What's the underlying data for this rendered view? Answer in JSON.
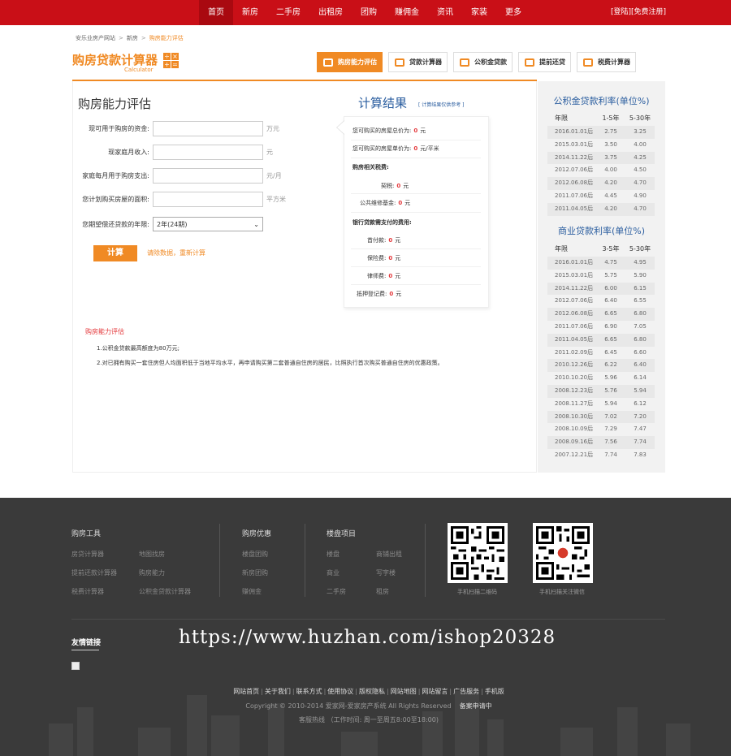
{
  "nav": {
    "items": [
      "首页",
      "新房",
      "二手房",
      "出租房",
      "团购",
      "赚佣金",
      "资讯",
      "家装",
      "更多"
    ],
    "auth": {
      "login": "[登陆]",
      "register": "[免费注册]"
    }
  },
  "breadcrumb": {
    "home": "安乐业房产网站",
    "sep1": ">",
    "mid": "新房",
    "sep2": ">",
    "current": "购房能力评估"
  },
  "logo": {
    "title": "购房贷款计算器",
    "subtitle": "Calculator"
  },
  "tools": [
    {
      "label": "购房能力评估",
      "icon": "house-icon"
    },
    {
      "label": "贷款计算器",
      "icon": "calculator-icon"
    },
    {
      "label": "公积金贷款",
      "icon": "money-icon"
    },
    {
      "label": "提前还贷",
      "icon": "coin-icon"
    },
    {
      "label": "税费计算器",
      "icon": "tax-icon"
    }
  ],
  "form": {
    "title": "购房能力评估",
    "funds": {
      "label": "现可用于购房的资金:",
      "unit": "万元",
      "value": ""
    },
    "income": {
      "label": "现家庭月收入:",
      "unit": "元",
      "value": ""
    },
    "expense": {
      "label": "家庭每月用于购房支出:",
      "unit": "元/月",
      "value": ""
    },
    "area": {
      "label": "您计划购买房屋的面积:",
      "unit": "平方米",
      "value": ""
    },
    "years": {
      "label": "您期望偿还贷款的年限:",
      "selected": "2年(24期)"
    },
    "calc_button": "计算",
    "reset": "请除数据，重新计算"
  },
  "result": {
    "title": "计算结果",
    "note": "[ 计算结果仅供参考 ]",
    "total_price": {
      "label": "您可购买的房屋总价为:",
      "value": "0",
      "unit": "元"
    },
    "unit_price": {
      "label": "您可购买的房屋单价为:",
      "value": "0",
      "unit": "元/平米"
    },
    "related_tax_head": "购房相关税费:",
    "deed_tax": {
      "label": "契税:",
      "value": "0",
      "unit": "元"
    },
    "maintenance": {
      "label": "公共维修基金:",
      "value": "0",
      "unit": "元"
    },
    "bank_head": "银行贷款需支付的费用:",
    "down_payment": {
      "label": "首付款:",
      "value": "0",
      "unit": "元"
    },
    "insurance": {
      "label": "保险费:",
      "value": "0",
      "unit": "元"
    },
    "notary": {
      "label": "律师费:",
      "value": "0",
      "unit": "元"
    },
    "mortgage_reg": {
      "label": "抵押登记费:",
      "value": "0",
      "unit": "元"
    }
  },
  "notes": {
    "title": "购房能力评估",
    "line1": "1.公积金贷款最高额度为80万元;",
    "line2": "2.对已拥有购买一套住房但人均面积低于当地平均水平，再申请购买第二套普通自住房的居民，比照执行首次购买普通自住房的优惠政策。"
  },
  "fund_rates": {
    "title": "公积金贷款利率(单位%)",
    "headers": [
      "年限",
      "1-5年",
      "5-30年"
    ],
    "rows": [
      [
        "2016.01.01后",
        "2.75",
        "3.25"
      ],
      [
        "2015.03.01后",
        "3.50",
        "4.00"
      ],
      [
        "2014.11.22后",
        "3.75",
        "4.25"
      ],
      [
        "2012.07.06后",
        "4.00",
        "4.50"
      ],
      [
        "2012.06.08后",
        "4.20",
        "4.70"
      ],
      [
        "2011.07.06后",
        "4.45",
        "4.90"
      ],
      [
        "2011.04.05后",
        "4.20",
        "4.70"
      ]
    ]
  },
  "commercial_rates": {
    "title": "商业贷款利率(单位%)",
    "headers": [
      "年限",
      "3-5年",
      "5-30年"
    ],
    "rows": [
      [
        "2016.01.01后",
        "4.75",
        "4.95"
      ],
      [
        "2015.03.01后",
        "5.75",
        "5.90"
      ],
      [
        "2014.11.22后",
        "6.00",
        "6.15"
      ],
      [
        "2012.07.06后",
        "6.40",
        "6.55"
      ],
      [
        "2012.06.08后",
        "6.65",
        "6.80"
      ],
      [
        "2011.07.06后",
        "6.90",
        "7.05"
      ],
      [
        "2011.04.05后",
        "6.65",
        "6.80"
      ],
      [
        "2011.02.09后",
        "6.45",
        "6.60"
      ],
      [
        "2010.12.26后",
        "6.22",
        "6.40"
      ],
      [
        "2010.10.20后",
        "5.96",
        "6.14"
      ],
      [
        "2008.12.23后",
        "5.76",
        "5.94"
      ],
      [
        "2008.11.27后",
        "5.94",
        "6.12"
      ],
      [
        "2008.10.30后",
        "7.02",
        "7.20"
      ],
      [
        "2008.10.09后",
        "7.29",
        "7.47"
      ],
      [
        "2008.09.16后",
        "7.56",
        "7.74"
      ],
      [
        "2007.12.21后",
        "7.74",
        "7.83"
      ]
    ]
  },
  "footer": {
    "col1": {
      "title": "购房工具",
      "links": [
        "房贷计算器",
        "地图找房",
        "提前还款计算器",
        "购房能力",
        "税费计算器",
        "公积金贷款计算器"
      ]
    },
    "col2": {
      "title": "购房优惠",
      "links": [
        "楼盘团购",
        "新房团购",
        "赚佣金"
      ]
    },
    "col3": {
      "title": "楼盘项目",
      "links": [
        "楼盘",
        "商铺出租",
        "商业",
        "写字楼",
        "二手房",
        "租房"
      ]
    },
    "qr1_label": "手机扫描二维码",
    "qr2_label": "手机扫描关注微信",
    "friend_links": "友情链接",
    "watermark": "https://www.huzhan.com/ishop20328",
    "bottom_links": [
      "网站首页",
      "关于我们",
      "联系方式",
      "使用协议",
      "版权隐私",
      "网站地图",
      "网站留言",
      "广告服务",
      "手机版"
    ],
    "copyright": "Copyright © 2010-2014 爱家网-爱家房产系统 All Rights Reserved",
    "beian": "备案申请中",
    "hotline": "客服热线 （工作时间: 周一至周五8:00至18:00)"
  },
  "colors": {
    "nav_red": "#c90f17",
    "orange": "#f08a24",
    "blue": "#2a5d9f",
    "footer_bg": "#3a3a3a"
  }
}
